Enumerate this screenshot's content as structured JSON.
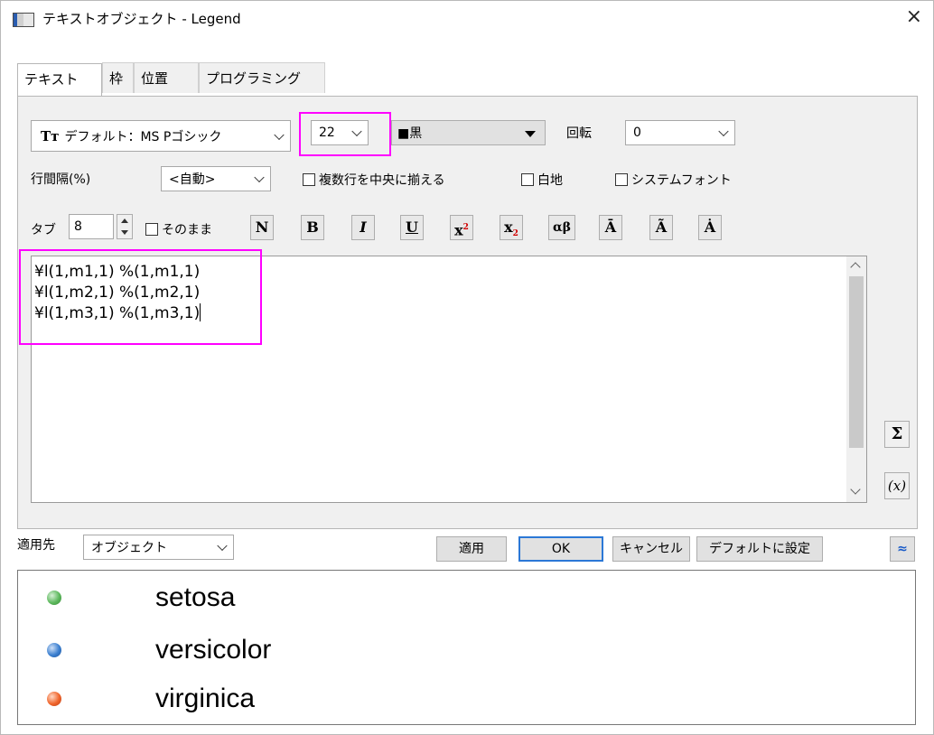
{
  "window": {
    "title": "テキストオブジェクト - Legend",
    "close_symbol": "×"
  },
  "tabs": [
    {
      "label": "テキスト"
    },
    {
      "label": "枠"
    },
    {
      "label": "位置"
    },
    {
      "label": "プログラミング"
    }
  ],
  "font": {
    "icon": "truetype-font-icon",
    "name": "デフォルト：MS Pゴシック"
  },
  "size": {
    "value": "22"
  },
  "color": {
    "swatch": "■",
    "name": "黒",
    "swatch_color": "#000000"
  },
  "rotation": {
    "label": "回転",
    "value": "0"
  },
  "line_spacing": {
    "label": "行間隔(%)",
    "value": "<自動>"
  },
  "checkboxes": {
    "center_multiline": "複数行を中央に揃える",
    "white_bg": "白地",
    "system_font": "システムフォント",
    "as_is": "そのまま"
  },
  "tab_stop": {
    "label": "タブ",
    "value": "8"
  },
  "format_buttons": {
    "normal": "N",
    "bold": "B",
    "italic": "I",
    "underline": "U",
    "superscript_base": "x",
    "superscript": "2",
    "subscript_base": "x",
    "subscript": "2",
    "greek": "αβ",
    "overbar": "Ā",
    "tilde": "Ã",
    "dot": "Ȧ"
  },
  "editor": {
    "lines": [
      "¥l(1,m1,1) %(1,m1,1)",
      "¥l(1,m2,1) %(1,m2,1)",
      "¥l(1,m3,1) %(1,m3,1)"
    ]
  },
  "side_buttons": {
    "sum": "Σ",
    "variable": "(x)"
  },
  "apply_to": {
    "label": "適用先",
    "value": "オブジェクト"
  },
  "buttons": {
    "apply": "適用",
    "ok": "OK",
    "cancel": "キャンセル",
    "set_default": "デフォルトに設定",
    "collapse": "≈"
  },
  "legend": [
    {
      "label": "setosa",
      "color": "#5cb85c"
    },
    {
      "label": "versicolor",
      "color": "#3a7fd0"
    },
    {
      "label": "virginica",
      "color": "#f0642a"
    }
  ]
}
